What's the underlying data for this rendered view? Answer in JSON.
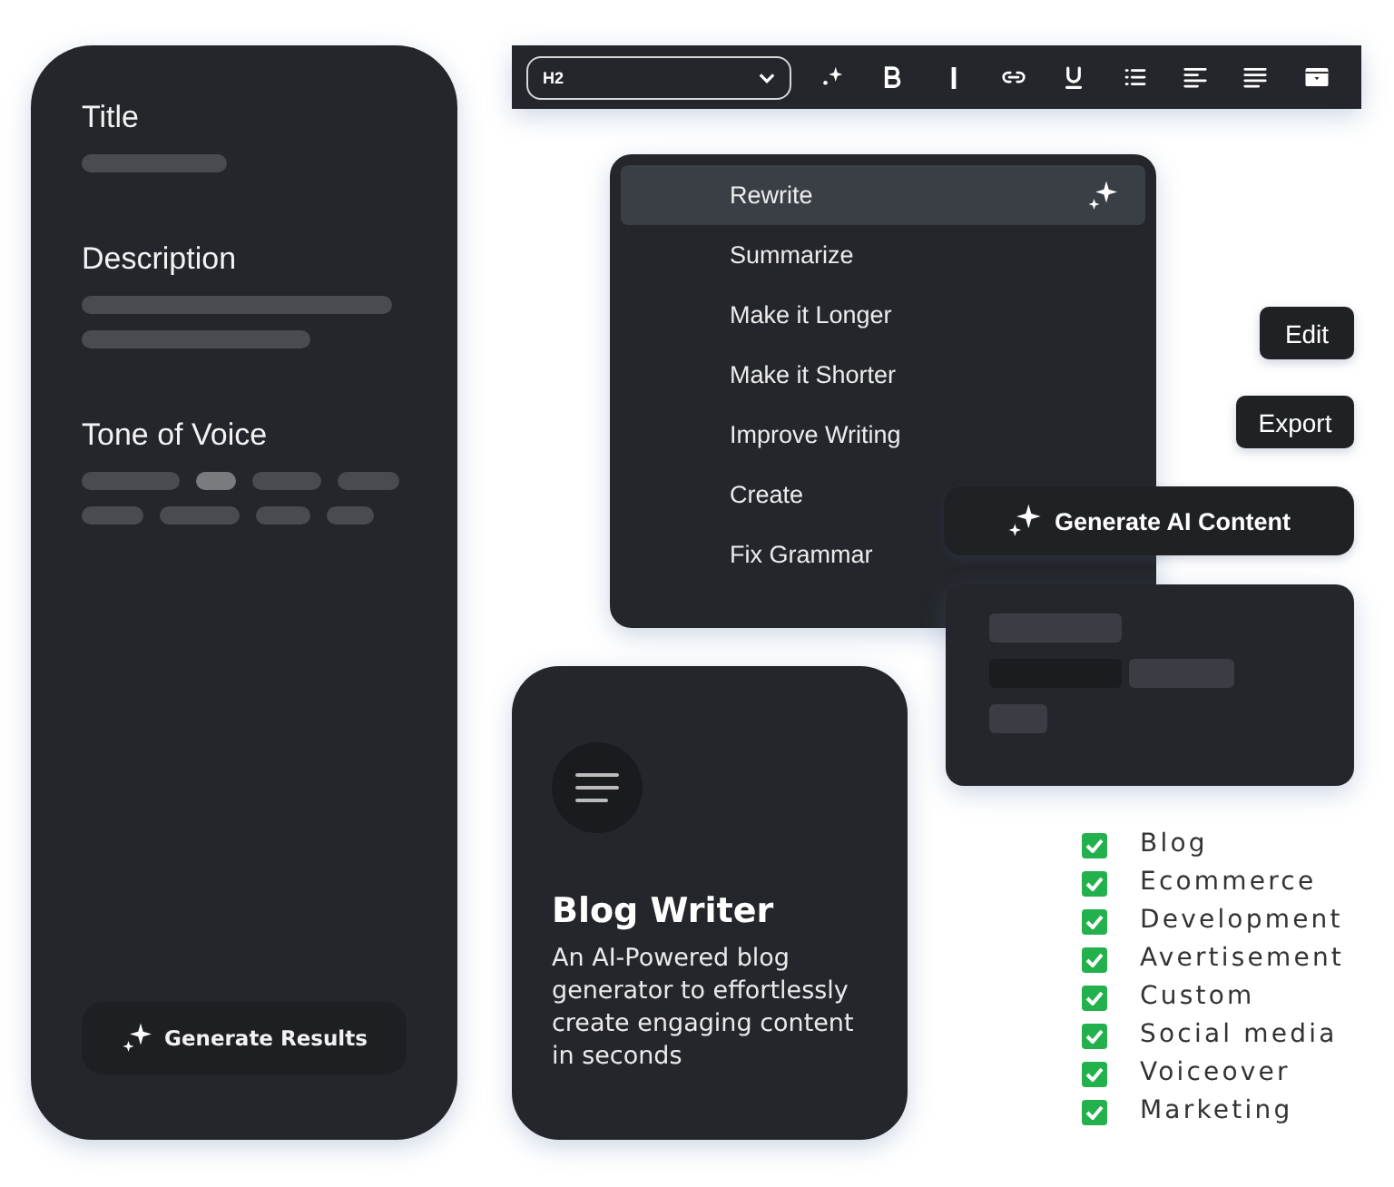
{
  "form_card": {
    "fields": [
      {
        "label": "Title",
        "kind": "single"
      },
      {
        "label": "Description",
        "kind": "double"
      },
      {
        "label": "Tone of Voice",
        "kind": "chips"
      }
    ],
    "tone_chips": [
      {
        "selected": false
      },
      {
        "selected": true
      },
      {
        "selected": false
      },
      {
        "selected": false
      },
      {
        "selected": false
      },
      {
        "selected": false
      },
      {
        "selected": false
      },
      {
        "selected": false
      }
    ],
    "button": "Generate Results"
  },
  "toolbar": {
    "heading_select": {
      "value": "H2"
    }
  },
  "ai_menu": {
    "items": [
      {
        "label": "Rewrite",
        "selected": true
      },
      {
        "label": "Summarize",
        "selected": false
      },
      {
        "label": "Make it Longer",
        "selected": false
      },
      {
        "label": "Make it Shorter",
        "selected": false
      },
      {
        "label": "Improve Writing",
        "selected": false
      },
      {
        "label": "Create",
        "selected": false
      },
      {
        "label": "Fix Grammar",
        "selected": false
      }
    ]
  },
  "buttons": {
    "edit": "Edit",
    "export": "Export",
    "generate": "Generate AI Content"
  },
  "blog_card": {
    "title": "Blog Writer",
    "description": "An AI-Powered blog generator to effortlessly create engaging content in seconds"
  },
  "checklist": [
    {
      "label": "Blog",
      "checked": true
    },
    {
      "label": "Ecommerce",
      "checked": true
    },
    {
      "label": "Development",
      "checked": true
    },
    {
      "label": "Avertisement",
      "checked": true
    },
    {
      "label": "Custom",
      "checked": true
    },
    {
      "label": "Social media",
      "checked": true
    },
    {
      "label": "Voiceover",
      "checked": true
    },
    {
      "label": "Marketing",
      "checked": true
    }
  ]
}
